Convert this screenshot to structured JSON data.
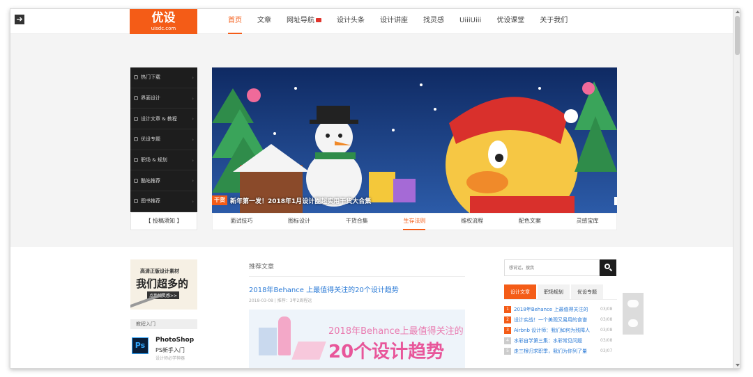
{
  "header": {
    "logo_main": "优设",
    "logo_sub": "uisdc.com",
    "nav": [
      "首页",
      "文章",
      "网址导航",
      "设计头条",
      "设计讲座",
      "找灵感",
      "UiiiUiii",
      "优设课堂",
      "关于我们"
    ],
    "active_nav": "首页"
  },
  "sidebar": {
    "items": [
      {
        "label": "热门下载",
        "icon": "download-icon"
      },
      {
        "label": "界面设计",
        "icon": "interface-icon"
      },
      {
        "label": "设计文章 & 教程",
        "icon": "article-icon"
      },
      {
        "label": "优设专题",
        "icon": "monitor-icon"
      },
      {
        "label": "职场 & 规划",
        "icon": "chat-icon"
      },
      {
        "label": "酷站推荐",
        "icon": "site-icon"
      },
      {
        "label": "图书推荐",
        "icon": "book-icon"
      }
    ],
    "submit_label": "【 投稿须知 】"
  },
  "banner": {
    "tag": "干货",
    "caption": "新年第一发！2018年1月设计圈超实用干货大合集"
  },
  "category_tabs": [
    "面试技巧",
    "图标设计",
    "干货合集",
    "生存法则",
    "维权流程",
    "配色文案",
    "灵感宝库"
  ],
  "active_category": "生存法则",
  "left_ad": {
    "line1": "高清正版设计素材",
    "line2": "我们超多的",
    "line3": "点我找灵感>>"
  },
  "beginner": {
    "section_label": "教程入门",
    "icon_text": "Ps",
    "title": "PhotoShop",
    "subtitle": "PS新手入门",
    "note": "设计师必学神器"
  },
  "recommended": {
    "label": "推荐文章",
    "article_title": "2018年Behance 上最值得关注的20个设计趋势",
    "article_meta": "2018-03-08 | 推荐：3年2周程远",
    "image_line1": "2018年Behance上最值得关注的",
    "image_line2": "20个设计趋势"
  },
  "search": {
    "placeholder": "想说话，搜我"
  },
  "right_tabs": [
    "设计文章",
    "职场规划",
    "优设专题"
  ],
  "active_right_tab": "设计文章",
  "right_list": [
    {
      "num": "1",
      "title": "2018年Behance 上最值得关注的",
      "date": "03/08"
    },
    {
      "num": "2",
      "title": "设计实战！一个美观又易用的食谱",
      "date": "03/08"
    },
    {
      "num": "3",
      "title": "Airbnb 设计师：我们如何为残障人",
      "date": "03/08"
    },
    {
      "num": "4",
      "title": "水彩自学第三集：水彩常见问题",
      "date": "03/08"
    },
    {
      "num": "5",
      "title": "走三根归求职季，我们为你列了量",
      "date": "03/07"
    }
  ],
  "colors": {
    "brand": "#f45c17",
    "link": "#2a7ad6",
    "dark_menu": "#1d1d1d"
  }
}
